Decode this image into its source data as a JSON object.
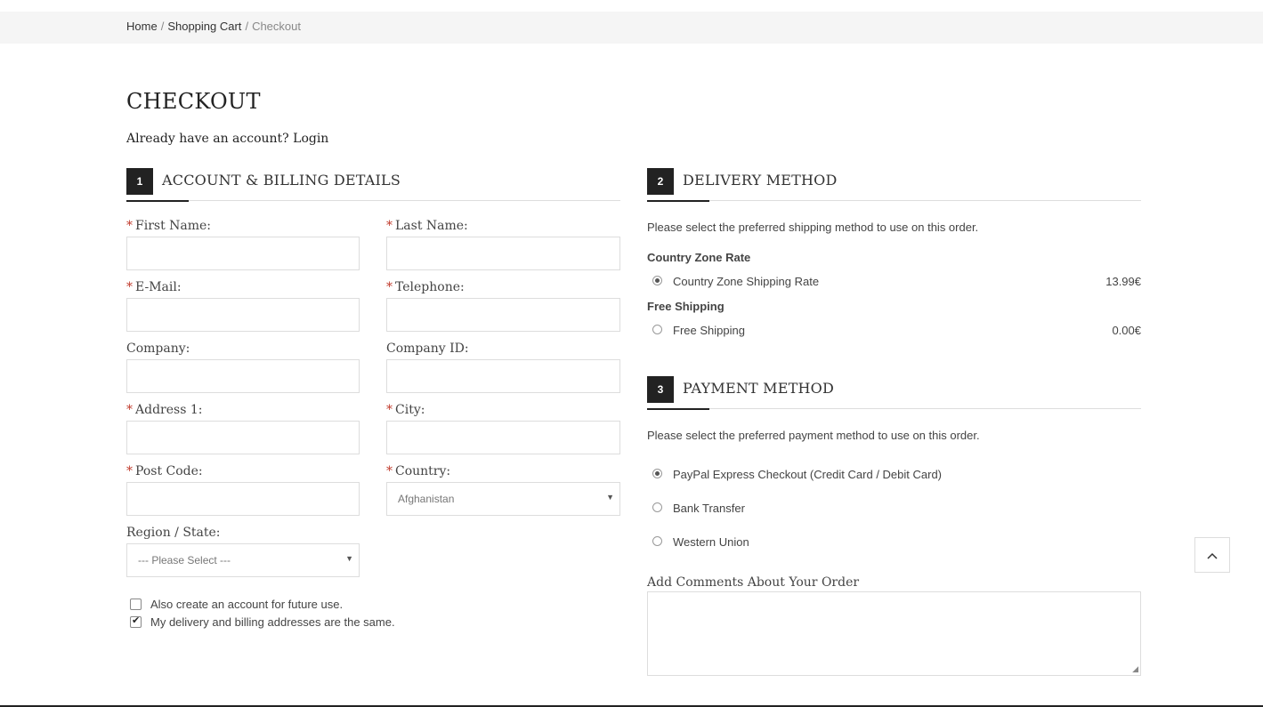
{
  "breadcrumb": {
    "home": "Home",
    "cart": "Shopping Cart",
    "current": "Checkout",
    "separator": "/"
  },
  "page": {
    "title": "CHECKOUT",
    "account_prompt": "Already have an account?",
    "login_link": "Login"
  },
  "account_section": {
    "number": "1",
    "title": "ACCOUNT & BILLING DETAILS",
    "required_marker": "*",
    "fields": {
      "first_name": "First Name:",
      "last_name": "Last Name:",
      "email": "E-Mail:",
      "telephone": "Telephone:",
      "company": "Company:",
      "company_id": "Company ID:",
      "address1": "Address 1:",
      "city": "City:",
      "post_code": "Post Code:",
      "country": "Country:",
      "region": "Region / State:"
    },
    "country_value": "Afghanistan",
    "region_value": "--- Please Select ---",
    "checkbox_create_account": "Also create an account for future use.",
    "checkbox_same_address": "My delivery and billing addresses are the same.",
    "create_account_checked": false,
    "same_address_checked": true
  },
  "delivery_section": {
    "number": "2",
    "title": "DELIVERY METHOD",
    "description": "Please select the preferred shipping method to use on this order.",
    "groups": [
      {
        "title": "Country Zone Rate",
        "option": "Country Zone Shipping Rate",
        "price": "13.99€",
        "selected": true
      },
      {
        "title": "Free Shipping",
        "option": "Free Shipping",
        "price": "0.00€",
        "selected": false
      }
    ]
  },
  "payment_section": {
    "number": "3",
    "title": "PAYMENT METHOD",
    "description": "Please select the preferred payment method to use on this order.",
    "options": [
      {
        "label": "PayPal Express Checkout (Credit Card / Debit Card)",
        "selected": true
      },
      {
        "label": "Bank Transfer",
        "selected": false
      },
      {
        "label": "Western Union",
        "selected": false
      }
    ]
  },
  "comments": {
    "label": "Add Comments About Your Order",
    "value": ""
  },
  "icons": {
    "scroll_top": "chevron-up-icon",
    "select_arrow": "caret-down-icon",
    "checkmark": "checkmark-icon",
    "resize": "resize-grip-icon"
  }
}
